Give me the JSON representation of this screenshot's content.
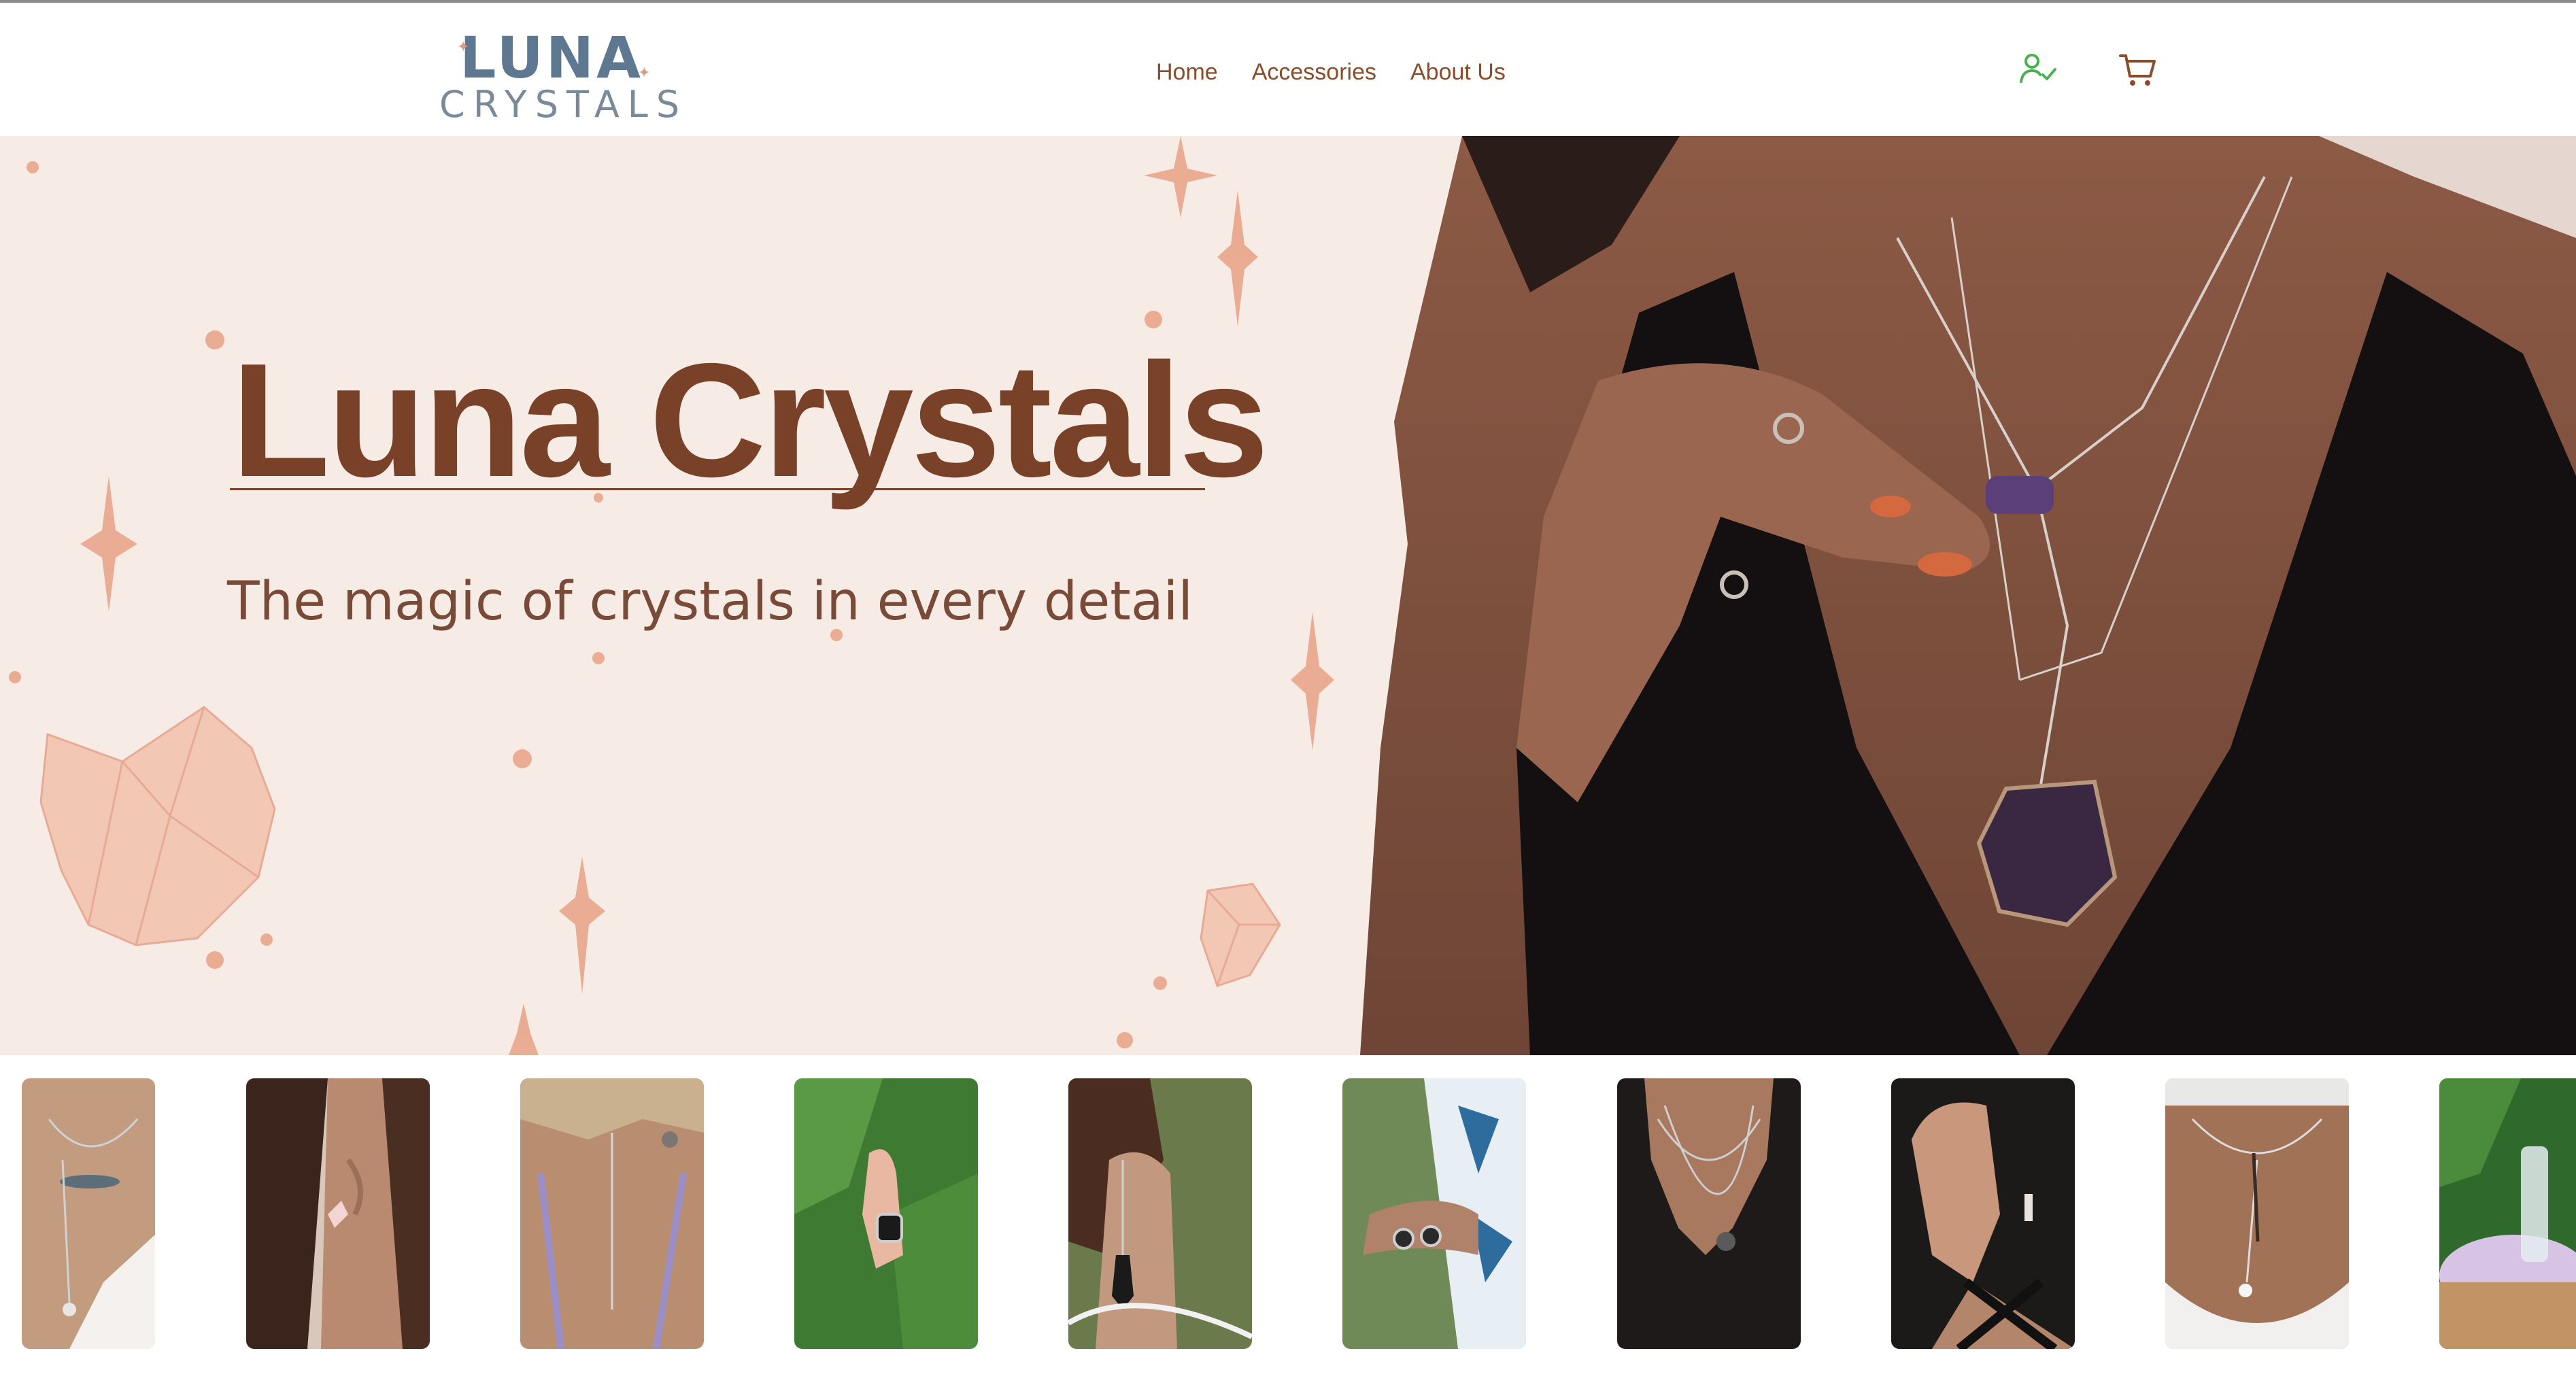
{
  "brand": {
    "name_line1": "LUNA",
    "name_line2": "CRYSTALS"
  },
  "nav": {
    "items": [
      {
        "label": "Home"
      },
      {
        "label": "Accessories"
      },
      {
        "label": "About Us"
      }
    ]
  },
  "header_icons": [
    {
      "name": "user-check-icon",
      "color": "#4caf50"
    },
    {
      "name": "cart-icon",
      "color": "#8a4d2a"
    }
  ],
  "hero": {
    "title": "Luna Crystals",
    "subtitle": "The magic of crystals in every detail",
    "background": "#f7ebe5",
    "title_color": "#7a4129"
  },
  "gallery": {
    "items": [
      {
        "subject": "necklace-on-chest-photo"
      },
      {
        "subject": "earring-on-ear-photo"
      },
      {
        "subject": "back-necklace-photo"
      },
      {
        "subject": "ring-on-hand-leaves-photo"
      },
      {
        "subject": "ear-cuff-photo"
      },
      {
        "subject": "bracelet-on-arm-photo"
      },
      {
        "subject": "pendant-necklace-photo"
      },
      {
        "subject": "smiling-woman-earring-photo"
      },
      {
        "subject": "back-chain-photo"
      },
      {
        "subject": "crystal-display-photo"
      }
    ]
  }
}
